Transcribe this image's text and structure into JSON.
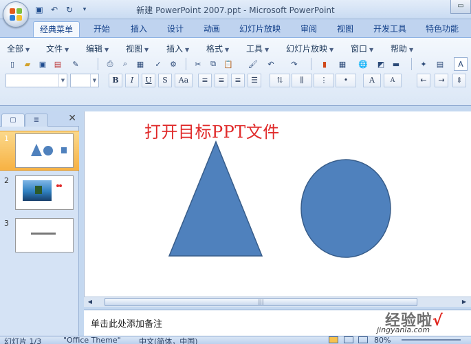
{
  "window": {
    "title": "新建 PowerPoint 2007.ppt - Microsoft PowerPoint",
    "restore_glyph": "▭"
  },
  "quick_access": [
    {
      "name": "save-icon",
      "glyph": "💾"
    },
    {
      "name": "undo-icon",
      "glyph": "↶"
    },
    {
      "name": "redo-icon",
      "glyph": "↻"
    },
    {
      "name": "customize-icon",
      "glyph": "▾"
    }
  ],
  "ribbon_tabs": [
    "经典菜单",
    "开始",
    "插入",
    "设计",
    "动画",
    "幻灯片放映",
    "审阅",
    "视图",
    "开发工具",
    "特色功能"
  ],
  "active_tab": "经典菜单",
  "classic_menus": [
    "全部",
    "文件",
    "编辑",
    "视图",
    "插入",
    "格式",
    "工具",
    "幻灯片放映",
    "窗口",
    "帮助"
  ],
  "format_buttons": {
    "bold": "B",
    "italic": "I",
    "underline": "U",
    "shadow": "S",
    "case": "Aa",
    "font_grow": "A",
    "font_shrink": "A"
  },
  "panel": {
    "tab_slides": "▢",
    "tab_outline": "≣",
    "close": "✕",
    "slides": [
      {
        "number": "1",
        "selected": true
      },
      {
        "number": "2",
        "selected": false
      },
      {
        "number": "3",
        "selected": false
      }
    ]
  },
  "slide": {
    "title": "打开目标PPT文件",
    "title_color": "#e02a2a",
    "shape_fill": "#4f81bd",
    "shape_stroke": "#385d8a"
  },
  "notes": {
    "placeholder": "单击此处添加备注"
  },
  "watermark": {
    "text": "经验啦",
    "check": "√",
    "url": "jingyanla.com"
  },
  "status": {
    "slide_count": "幻灯片 1/3",
    "theme": "\"Office Theme\"",
    "language": "中文(简体，中国)",
    "zoom": "80%"
  },
  "colors": {
    "accent": "#15428b",
    "ribbon": "#dbe7f6",
    "selected_thumb": "#f7b243"
  }
}
